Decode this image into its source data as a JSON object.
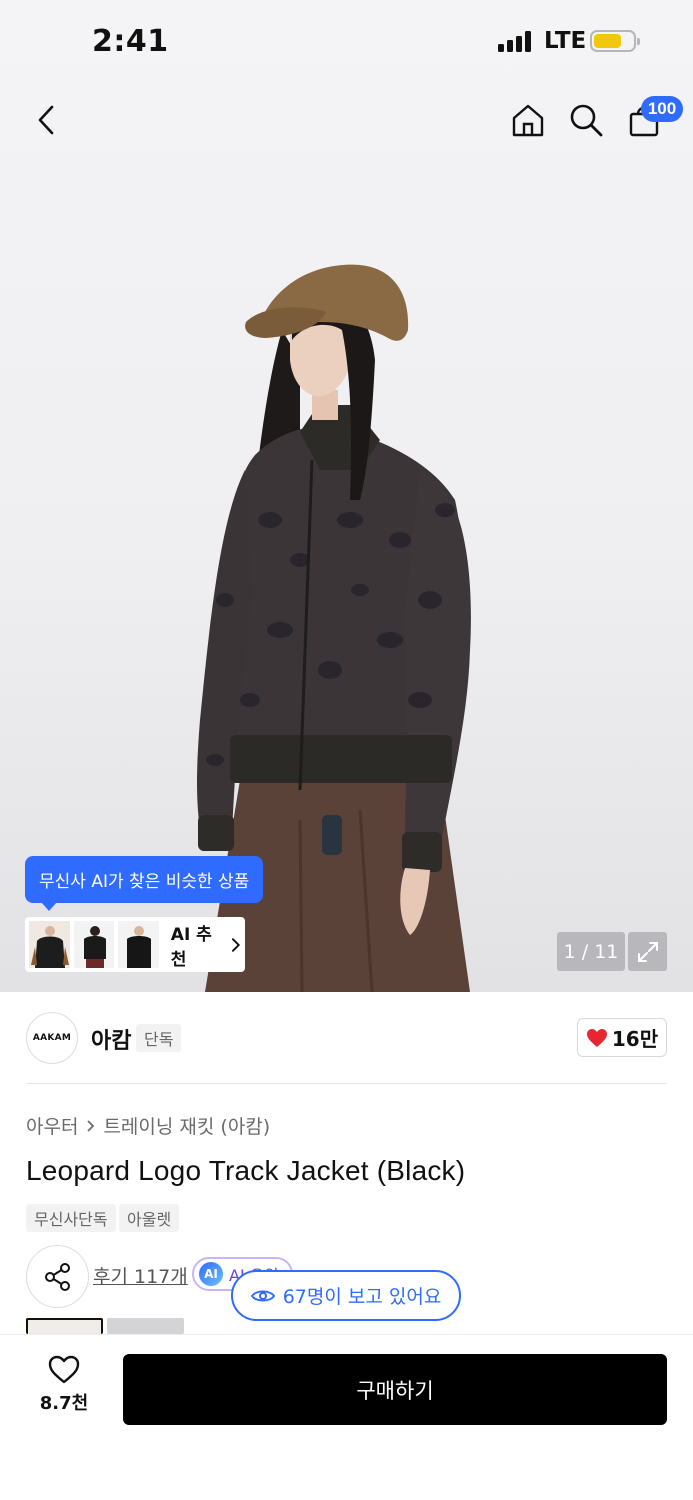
{
  "status_bar": {
    "time": "2:41",
    "network": "LTE",
    "battery_level": 0.7
  },
  "nav": {
    "back_icon": "chevron-left-icon",
    "home_icon": "home-icon",
    "search_icon": "search-icon",
    "cart_icon": "shopping-bag-icon",
    "cart_count": "100"
  },
  "hero": {
    "ai_tooltip": "무신사 AI가 찾은 비슷한 상품",
    "ai_recommend_label": "AI 추천",
    "image_counter": "1 / 11",
    "expand_icon": "expand-icon"
  },
  "brand": {
    "logo_text": "AAKAM",
    "name": "아캄",
    "tag": "단독",
    "like_count": "16만"
  },
  "product": {
    "breadcrumb": [
      "아우터",
      "트레이닝 재킷 (아캄)"
    ],
    "title": "Leopard Logo Track Jacket (Black)",
    "tags": [
      "무신사단독",
      "아울렛"
    ],
    "reviews": "후기 117개",
    "ai_badge": "AI 요약",
    "viewers": "67명이 보고 있어요"
  },
  "bottom_bar": {
    "wish_count": "8.7천",
    "buy_label": "구매하기"
  },
  "colors": {
    "accent": "#2f6bff",
    "buy_button": "#000000",
    "heart": "#e8262f",
    "battery": "#f2c80f"
  }
}
